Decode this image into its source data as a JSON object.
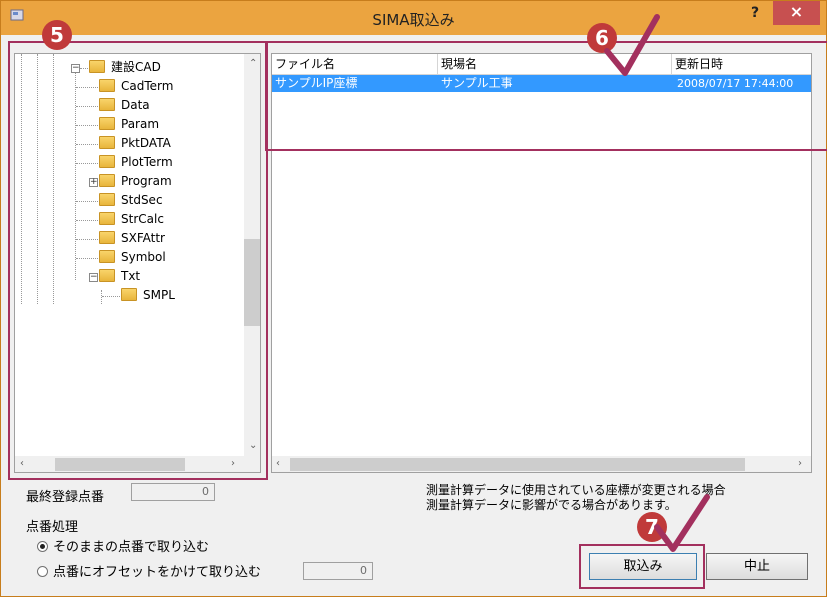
{
  "window": {
    "title": "SIMA取込み",
    "help_label": "?",
    "close_label": "×"
  },
  "tree": {
    "items": [
      {
        "label": "建設CAD"
      },
      {
        "label": "CadTerm"
      },
      {
        "label": "Data"
      },
      {
        "label": "Param"
      },
      {
        "label": "PktDATA"
      },
      {
        "label": "PlotTerm"
      },
      {
        "label": "Program"
      },
      {
        "label": "StdSec"
      },
      {
        "label": "StrCalc"
      },
      {
        "label": "SXFAttr"
      },
      {
        "label": "Symbol"
      },
      {
        "label": "Txt"
      },
      {
        "label": "SMPL"
      }
    ]
  },
  "list": {
    "columns": [
      "ファイル名",
      "現場名",
      "更新日時"
    ],
    "rows": [
      [
        "サンプルIP座標",
        "サンプル工事",
        "2008/07/17 17:44:00"
      ]
    ]
  },
  "bottom": {
    "last_point_label": "最終登録点番",
    "last_point_value": "0",
    "numbering_label": "点番処理",
    "radio_keep_label": "そのままの点番で取り込む",
    "radio_offset_label": "点番にオフセットをかけて取り込む",
    "offset_value": "0",
    "info_line1": "測量計算データに使用されている座標が変更される場合",
    "info_line2": "測量計算データに影響がでる場合があります。",
    "import_button": "取込み",
    "cancel_button": "中止"
  },
  "annotations": {
    "step5": "5",
    "step6": "6",
    "step7": "7",
    "accent_color": "#a3305e",
    "badge_color": "#c03a3a"
  }
}
